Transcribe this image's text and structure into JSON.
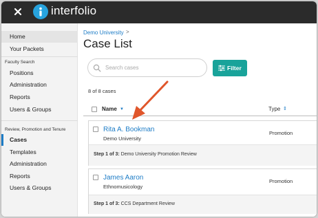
{
  "app": {
    "close_label": "×",
    "brand": "interfolio",
    "brand_color": "#27a3de",
    "accent": "#1d7cc6",
    "filter_color": "#19a39a"
  },
  "sidebar": {
    "top_items": [
      {
        "label": "Home"
      },
      {
        "label": "Your Packets"
      }
    ],
    "faculty_search": {
      "heading": "Faculty Search",
      "items": [
        {
          "label": "Positions"
        },
        {
          "label": "Administration"
        },
        {
          "label": "Reports"
        },
        {
          "label": "Users & Groups"
        }
      ]
    },
    "rpt": {
      "heading": "Review, Promotion and Tenure",
      "items": [
        {
          "label": "Cases"
        },
        {
          "label": "Templates"
        },
        {
          "label": "Administration"
        },
        {
          "label": "Reports"
        },
        {
          "label": "Users & Groups"
        }
      ]
    }
  },
  "main": {
    "breadcrumb": "Demo University",
    "breadcrumb_sep": ">",
    "title": "Case List",
    "search_placeholder": "Search cases",
    "filter_label": "Filter",
    "count": "8 of 8 cases",
    "columns": {
      "name": "Name",
      "type": "Type"
    },
    "cases": [
      {
        "name": "Rita A. Bookman",
        "unit": "Demo University",
        "type": "Promotion",
        "step_prefix": "Step 1 of 3:",
        "step_text": " Demo University Promotion Review"
      },
      {
        "name": "James Aaron",
        "unit": "Ethnomusicology",
        "type": "Promotion",
        "step_prefix": "Step 1 of 3:",
        "step_text": " CCS Department Review"
      }
    ]
  },
  "annotation": {
    "arrow_color": "#e0562b"
  }
}
